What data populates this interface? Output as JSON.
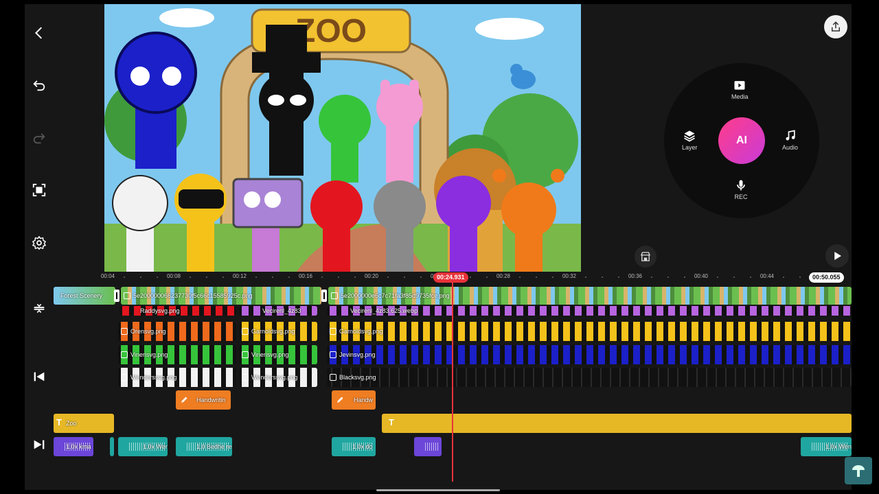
{
  "header": {
    "back_icon": "back-arrow-icon",
    "export_icon": "export-icon"
  },
  "toolbar": {
    "undo_icon": "undo-icon",
    "redo_icon": "redo-icon",
    "fullscreen_icon": "fullscreen-icon",
    "settings_icon": "gear-icon"
  },
  "preview": {
    "sign_text": "ZOO"
  },
  "add_menu": {
    "media_label": "Media",
    "layer_label": "Layer",
    "audio_label": "Audio",
    "rec_label": "REC",
    "ai_label": "AI"
  },
  "timeline": {
    "ruler_ticks": [
      "00:04",
      "00:08",
      "00:12",
      "00:16",
      "00:20",
      "00:24",
      "00:28",
      "00:32",
      "00:36",
      "00:40",
      "00:44"
    ],
    "current_time": "00:24.931",
    "total_time": "00:50.055",
    "main_clips": [
      "Forest Scenery",
      "5e200000066237730f5c66c15585925c.png",
      "5e2000000e6c7c71fa3f85d9735fce.png"
    ],
    "overlay_row1": [
      "Raddysvg.png",
      "Vecirenl_4z83",
      "Vecirenl_4z83.625.webp"
    ],
    "overlay_row2": [
      "Orensvg.png",
      "Garnoldsvg.png",
      "Garnoldsvg.png"
    ],
    "overlay_row3": [
      "Vinerisvg.png",
      "Vinerisvg.png",
      "Jevinsvg.png"
    ],
    "overlay_row4": [
      "Wenderssvg.png",
      "Wenderssvg.png",
      "Blacksvg.png"
    ],
    "handwriting": [
      "Handwritin",
      "Handw"
    ],
    "text_clips": [
      "Zoo"
    ],
    "audio_clips": [
      "1.0x kma",
      "1.0x Wen",
      "1.0 Bedhe re",
      "1.0x do",
      "1.0x Wen"
    ]
  },
  "colors": {
    "accent": "#e8323a",
    "ai_gradient": "#ff3d8a",
    "text_track": "#e6b826",
    "handwriting": "#ef7d22",
    "audio": "#20a6a0"
  }
}
